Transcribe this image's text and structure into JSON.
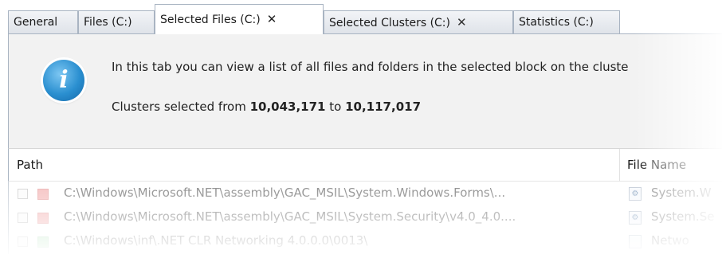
{
  "tabs": [
    {
      "label": "General",
      "active": false,
      "closable": false
    },
    {
      "label": "Files (C:)",
      "active": false,
      "closable": false
    },
    {
      "label": "Selected Files (C:)",
      "active": true,
      "closable": true
    },
    {
      "label": "Selected Clusters (C:)",
      "active": false,
      "closable": true
    },
    {
      "label": "Statistics (C:)",
      "active": false,
      "closable": false
    }
  ],
  "tab_close_glyph": "✕",
  "info": {
    "icon": "info-icon",
    "icon_glyph": "i",
    "description": "In this tab you can view a list of all files and folders in the selected block on the cluste",
    "clusters_prefix": "Clusters selected from ",
    "clusters_from": "10,043,171",
    "clusters_mid": " to ",
    "clusters_to": "10,117,017"
  },
  "columns": {
    "path": "Path",
    "file_name_a": "File",
    "file_name_b": " Name"
  },
  "rows": [
    {
      "path": "C:\\Windows\\Microsoft.NET\\assembly\\GAC_MSIL\\System.Windows.Forms\\...",
      "file_name": "System.W",
      "swatch_color": "#f1a3a3",
      "swatch_border": "#e08a8a"
    },
    {
      "path": "C:\\Windows\\Microsoft.NET\\assembly\\GAC_MSIL\\System.Security\\v4.0_4.0....",
      "file_name": "System.Se",
      "swatch_color": "#f1a3a3",
      "swatch_border": "#e08a8a"
    },
    {
      "path": "C:\\Windows\\inf\\.NET CLR Networking 4.0.0.0\\0013\\",
      "file_name": "Netwo",
      "swatch_color": "#a8dfb0",
      "swatch_border": "#8cc998"
    }
  ],
  "colors": {
    "tab_border": "#a9b4c2",
    "panel_bg": "#f2f2f2",
    "info_blue": "#2a8fd0"
  }
}
